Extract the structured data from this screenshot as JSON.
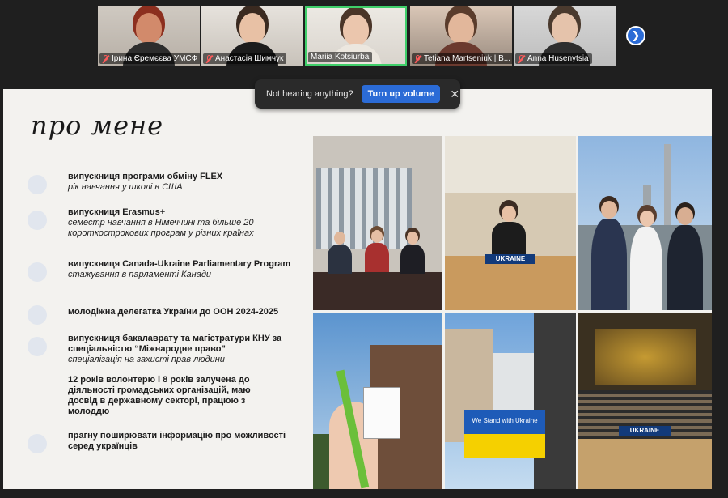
{
  "participants": [
    {
      "name": "Ірина Єремєєва УМСФ",
      "active": false,
      "muted": true
    },
    {
      "name": "Анастасія Шимчук",
      "active": false,
      "muted": true
    },
    {
      "name": "Mariia Kotsiurba",
      "active": true,
      "muted": false
    },
    {
      "name": "Tetiana Martseniuk | B...",
      "active": false,
      "muted": true
    },
    {
      "name": "Anna Husenytsia",
      "active": false,
      "muted": true
    }
  ],
  "next_button": {
    "icon": "chevron-right-icon",
    "glyph": "❯"
  },
  "toast": {
    "message": "Not hearing anything?",
    "button": "Turn up volume",
    "close_glyph": "✕"
  },
  "slide": {
    "title": "про мене",
    "bullets": [
      {
        "title": "випускниця програми обміну FLEX",
        "sub": "рік навчання у школі в США"
      },
      {
        "title": "випускниця Erasmus+",
        "sub": "семестр навчання в Німеччині та більше 20 короткострокових програм у різних країнах"
      },
      {
        "title": "випускниця Canada-Ukraine Parliamentary Program",
        "sub": "стажування в парламенті Канади"
      },
      {
        "title": "молодіжна делегатка України до ООН 2024-2025",
        "sub": ""
      },
      {
        "title": "випускниця бакалаврату та магістратури КНУ за спеціальністю “Міжнародне право”",
        "sub": "спеціалізація на захисті прав людини"
      },
      {
        "title": "12 років волонтерю і 8 років залучена до діяльності громадських організацій, маю досвід в державному секторі, працюю з молоддю",
        "sub": ""
      },
      {
        "title": "прагну поширювати інформацію про можливості серед українців",
        "sub": ""
      }
    ],
    "photo_texts": {
      "ukraine_sign": "UKRAINE",
      "ukraine_sign_2": "UKRAINE",
      "stand_with": "We Stand with Ukraine"
    }
  },
  "colors": {
    "active_tile_border": "#3fcf6a",
    "toast_button": "#2b6bd6",
    "slide_bg": "#f3f2ef"
  }
}
